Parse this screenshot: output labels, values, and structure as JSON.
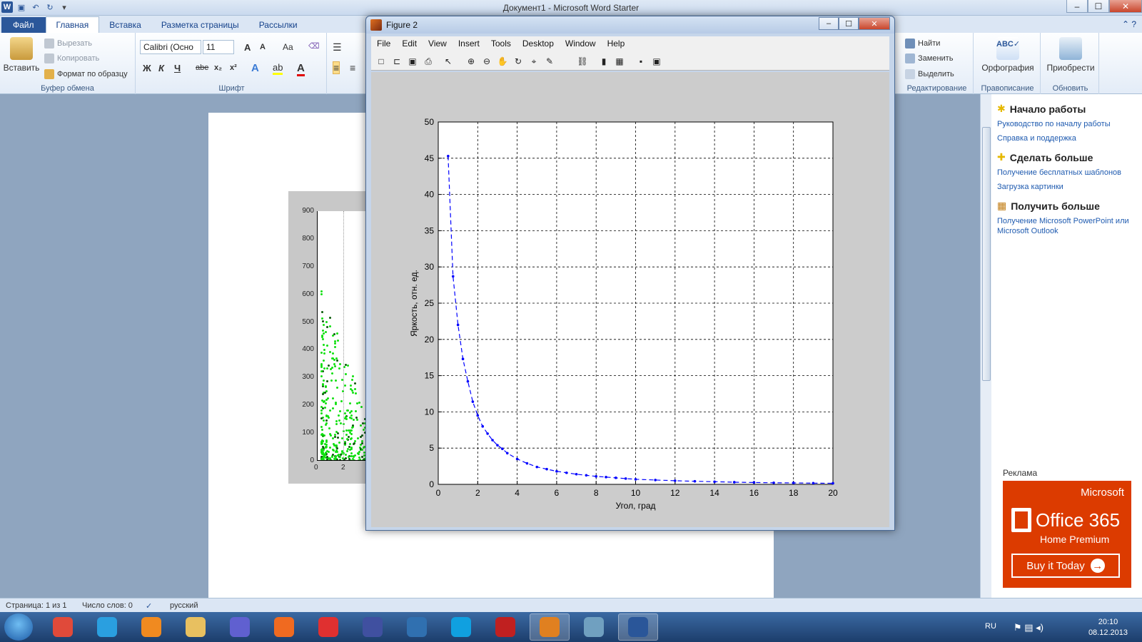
{
  "word": {
    "title": "Документ1 - Microsoft Word Starter",
    "qat": {
      "logo": "W",
      "save_icon": "save-icon",
      "undo_icon": "undo-icon",
      "redo_icon": "redo-icon"
    },
    "window_buttons": {
      "minimize": "–",
      "maximize": "☐",
      "close": "✕"
    },
    "tabs": [
      {
        "label": "Файл"
      },
      {
        "label": "Главная"
      },
      {
        "label": "Вставка"
      },
      {
        "label": "Разметка страницы"
      },
      {
        "label": "Рассылки"
      }
    ],
    "ribbon": {
      "clipboard": {
        "paste": "Вставить",
        "cut": "Вырезать",
        "copy": "Копировать",
        "format_painter": "Формат по образцу",
        "label": "Буфер обмена"
      },
      "font": {
        "font_name": "Calibri (Осно",
        "font_size": "11",
        "bold": "Ж",
        "italic": "К",
        "underline": "Ч",
        "strike": "abe",
        "subscript": "x₂",
        "superscript": "x²",
        "grow": "A",
        "shrink": "A",
        "case": "Aa",
        "label": "Шрифт"
      },
      "editing": {
        "find": "Найти",
        "replace": "Заменить",
        "select": "Выделить",
        "label": "Редактирование"
      },
      "proofing": {
        "spelling": "Орфография",
        "label": "Правописание"
      },
      "update": {
        "buy": "Приобрести",
        "label": "Обновить"
      }
    },
    "embedded_plot": {
      "yticks": [
        "900",
        "800",
        "700",
        "600",
        "500",
        "400",
        "300",
        "200",
        "100",
        "0"
      ],
      "xticks": [
        "0",
        "2"
      ]
    },
    "task_pane": {
      "sections": [
        {
          "heading": "Начало работы",
          "links": [
            "Руководство по началу работы",
            "Справка и поддержка"
          ]
        },
        {
          "heading": "Сделать больше",
          "links": [
            "Получение бесплатных шаблонов",
            "Загрузка картинки"
          ]
        },
        {
          "heading": "Получить больше",
          "links": [
            "Получение Microsoft PowerPoint или Microsoft Outlook"
          ]
        }
      ],
      "ad_label": "Реклама",
      "ad": {
        "brand": "Microsoft",
        "product": "Office 365",
        "edition": "Home Premium",
        "cta": "Buy it Today"
      }
    },
    "status": {
      "page": "Страница: 1 из 1",
      "words": "Число слов: 0",
      "language": "русский"
    }
  },
  "taskbar": {
    "apps": [
      "chrome-icon",
      "ie-icon",
      "media-player-icon",
      "explorer-icon",
      "fractal-icon",
      "firefox-icon",
      "yandex-icon",
      "notepad-icon",
      "globe-icon",
      "skype-icon",
      "pdf-icon",
      "matlab-icon",
      "image-viewer-icon",
      "word-icon"
    ],
    "language": "RU",
    "time": "20:10",
    "date": "08.12.2013"
  },
  "figure": {
    "title": "Figure 2",
    "window_buttons": {
      "minimize": "–",
      "maximize": "☐",
      "close": "✕"
    },
    "menu": [
      "File",
      "Edit",
      "View",
      "Insert",
      "Tools",
      "Desktop",
      "Window",
      "Help"
    ],
    "toolbar": [
      "new-figure-icon",
      "open-icon",
      "save-icon",
      "print-icon",
      "pointer-icon",
      "zoom-in-icon",
      "zoom-out-icon",
      "pan-icon",
      "rotate-icon",
      "data-cursor-icon",
      "brush-icon",
      "link-icon",
      "colorbar-icon",
      "legend-icon",
      "hide-plot-tools-icon",
      "show-plot-tools-icon"
    ]
  },
  "chart_data": {
    "type": "line",
    "xlabel": "Угол, град",
    "ylabel": "Яркость, отн. ед.",
    "xlim": [
      0,
      20
    ],
    "ylim": [
      0,
      50
    ],
    "xticks": [
      "0",
      "2",
      "4",
      "6",
      "8",
      "10",
      "12",
      "14",
      "16",
      "18",
      "20"
    ],
    "yticks": [
      "0",
      "5",
      "10",
      "15",
      "20",
      "25",
      "30",
      "35",
      "40",
      "45",
      "50"
    ],
    "grid": true,
    "line_color": "#0000ff",
    "line_style": "dashed",
    "marker": "dot",
    "series": [
      {
        "x": [
          0.5,
          0.75,
          1.0,
          1.25,
          1.5,
          1.75,
          2.0,
          2.25,
          2.5,
          2.75,
          3.0,
          3.25,
          3.5,
          4.0,
          4.5,
          5.0,
          5.5,
          6.0,
          6.5,
          7.0,
          7.5,
          8.0,
          8.5,
          9.0,
          9.5,
          10.0,
          11.0,
          12.0,
          13.0,
          14.0,
          15.0,
          16.0,
          17.0,
          18.0,
          19.0,
          20.0
        ],
        "y": [
          45.3,
          28.7,
          22.0,
          17.3,
          14.2,
          11.4,
          9.5,
          8.0,
          7.0,
          6.1,
          5.4,
          4.9,
          4.3,
          3.5,
          2.9,
          2.4,
          2.1,
          1.8,
          1.6,
          1.4,
          1.25,
          1.1,
          1.0,
          0.9,
          0.8,
          0.7,
          0.6,
          0.5,
          0.42,
          0.36,
          0.3,
          0.26,
          0.22,
          0.2,
          0.17,
          0.15
        ]
      }
    ]
  }
}
